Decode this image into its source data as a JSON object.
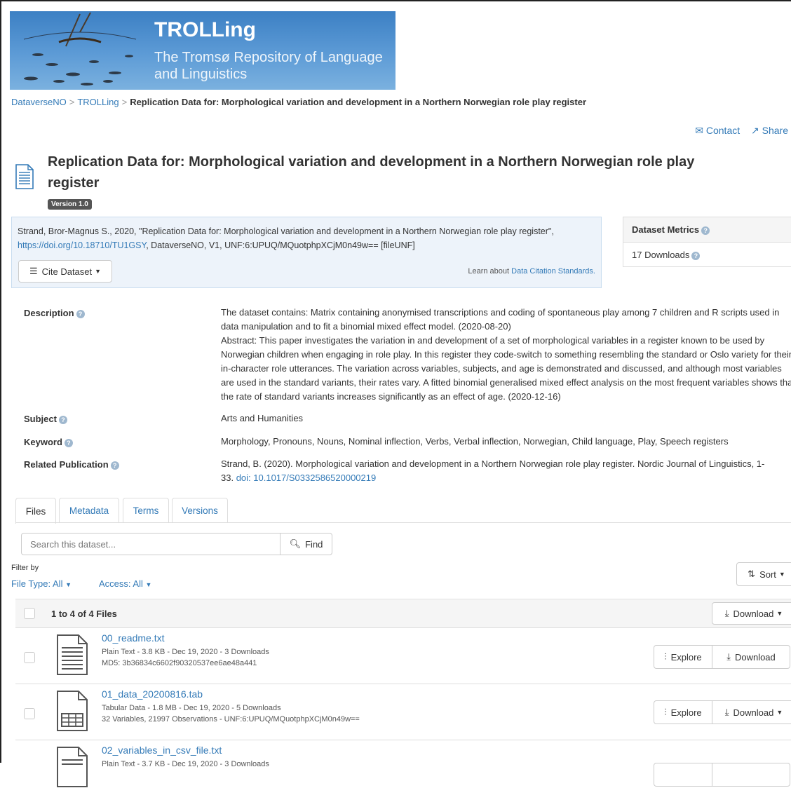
{
  "banner": {
    "title": "TROLLing",
    "subtitle": "The Tromsø Repository of Language and Linguistics"
  },
  "breadcrumb": {
    "items": [
      "DataverseNO",
      "TROLLing"
    ],
    "separator": ">",
    "current": "Replication Data for: Morphological variation and development in a Northern Norwegian role play register"
  },
  "top_actions": {
    "contact": "Contact",
    "share": "Share"
  },
  "dataset": {
    "title": "Replication Data for: Morphological variation and development in a Northern Norwegian role play register",
    "version": "Version 1.0"
  },
  "citation": {
    "text_before": "Strand, Bror-Magnus S., 2020, \"Replication Data for: Morphological variation and development in a Northern Norwegian role play register\", ",
    "doi_link": "https://doi.org/10.18710/TU1GSY",
    "text_after": ", DataverseNO, V1, UNF:6:UPUQ/MQuotphpXCjM0n49w== [fileUNF]",
    "cite_button": "Cite Dataset",
    "learn_prefix": "Learn about ",
    "learn_link": "Data Citation Standards."
  },
  "metrics": {
    "header": "Dataset Metrics",
    "downloads": "17 Downloads"
  },
  "metadata": {
    "description_label": "Description",
    "description": "The dataset contains: Matrix containing anonymised transcriptions and coding of spontaneous play among 7 children and R scripts used in data manipulation and to fit a binomial mixed effect model. (2020-08-20)",
    "abstract": "Abstract: This paper investigates the variation in and development of a set of morphological variables in a register known to be used by Norwegian children when engaging in role play. In this register they code-switch to something resembling the standard or Oslo variety for their in-character role utterances. The variation across variables, subjects, and age is demonstrated and discussed, and although most variables are used in the standard variants, their rates vary. A fitted binomial generalised mixed effect analysis on the most frequent variables shows that the rate of standard variants increases significantly as an effect of age. (2020-12-16)",
    "subject_label": "Subject",
    "subject": "Arts and Humanities",
    "keyword_label": "Keyword",
    "keyword": "Morphology, Pronouns, Nouns, Nominal inflection, Verbs, Verbal inflection, Norwegian, Child language, Play, Speech registers",
    "related_label": "Related Publication",
    "related_text": "Strand, B. (2020). Morphological variation and development in a Northern Norwegian role play register. Nordic Journal of Linguistics, 1-33.",
    "related_doi": "doi: 10.1017/S0332586520000219"
  },
  "tabs": [
    {
      "label": "Files"
    },
    {
      "label": "Metadata"
    },
    {
      "label": "Terms"
    },
    {
      "label": "Versions"
    }
  ],
  "files_panel": {
    "search_placeholder": "Search this dataset...",
    "find_button": "Find",
    "filter_by": "Filter by",
    "file_type": "File Type: All",
    "access": "Access: All",
    "sort": "Sort",
    "count": "1 to 4 of 4 Files",
    "download_all": "Download"
  },
  "files": [
    {
      "name": "00_readme.txt",
      "info1": "Plain Text - 3.8 KB - Dec 19, 2020 - 3 Downloads",
      "info2": "MD5: 3b36834c6602f90320537ee6ae48a441",
      "explore": "Explore",
      "download": "Download"
    },
    {
      "name": "01_data_20200816.tab",
      "info1": "Tabular Data - 1.8 MB - Dec 19, 2020 - 5 Downloads",
      "info2": "32 Variables, 21997 Observations - UNF:6:UPUQ/MQuotphpXCjM0n49w==",
      "explore": "Explore",
      "download": "Download"
    },
    {
      "name": "02_variables_in_csv_file.txt",
      "info1": "Plain Text - 3.7 KB - Dec 19, 2020 - 3 Downloads"
    }
  ],
  "colors": {
    "link": "#337ab7",
    "citation_bg": "#edf3fa",
    "badge_bg": "#555555"
  }
}
